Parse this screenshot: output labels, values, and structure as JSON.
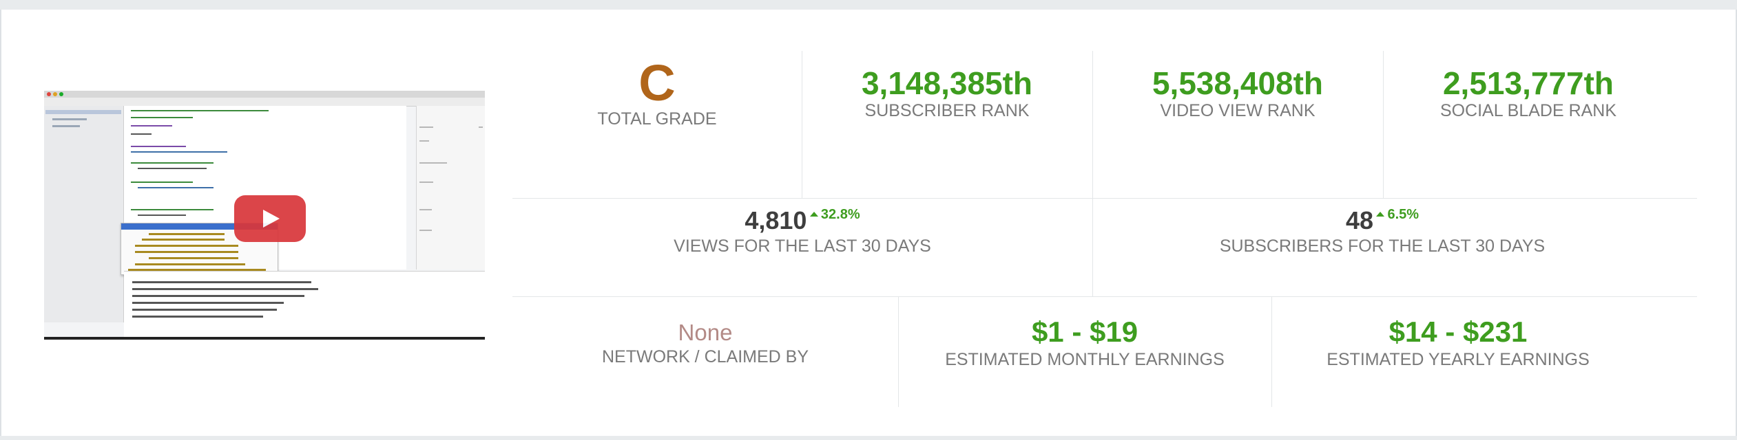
{
  "video": {
    "play_icon": "play-button-icon"
  },
  "grade": {
    "value": "C",
    "label": "TOTAL GRADE",
    "color": "#b0651a"
  },
  "ranks": [
    {
      "value": "3,148,385th",
      "label": "SUBSCRIBER RANK"
    },
    {
      "value": "5,538,408th",
      "label": "VIDEO VIEW RANK"
    },
    {
      "value": "2,513,777th",
      "label": "SOCIAL BLADE RANK"
    }
  ],
  "last30": {
    "views": {
      "value": "4,810",
      "change": "32.8%",
      "label": "VIEWS FOR THE LAST 30 DAYS"
    },
    "subscribers": {
      "value": "48",
      "change": "6.5%",
      "label": "SUBSCRIBERS FOR THE LAST 30 DAYS"
    }
  },
  "network": {
    "value": "None",
    "label": "NETWORK / CLAIMED BY"
  },
  "earnings": {
    "monthly": {
      "value": "$1 - $19",
      "label": "ESTIMATED MONTHLY EARNINGS"
    },
    "yearly": {
      "value": "$14 - $231",
      "label": "ESTIMATED YEARLY EARNINGS"
    }
  },
  "colors": {
    "positive": "#3e9d1f",
    "label": "#7a7a7a",
    "play": "#d9363a"
  }
}
